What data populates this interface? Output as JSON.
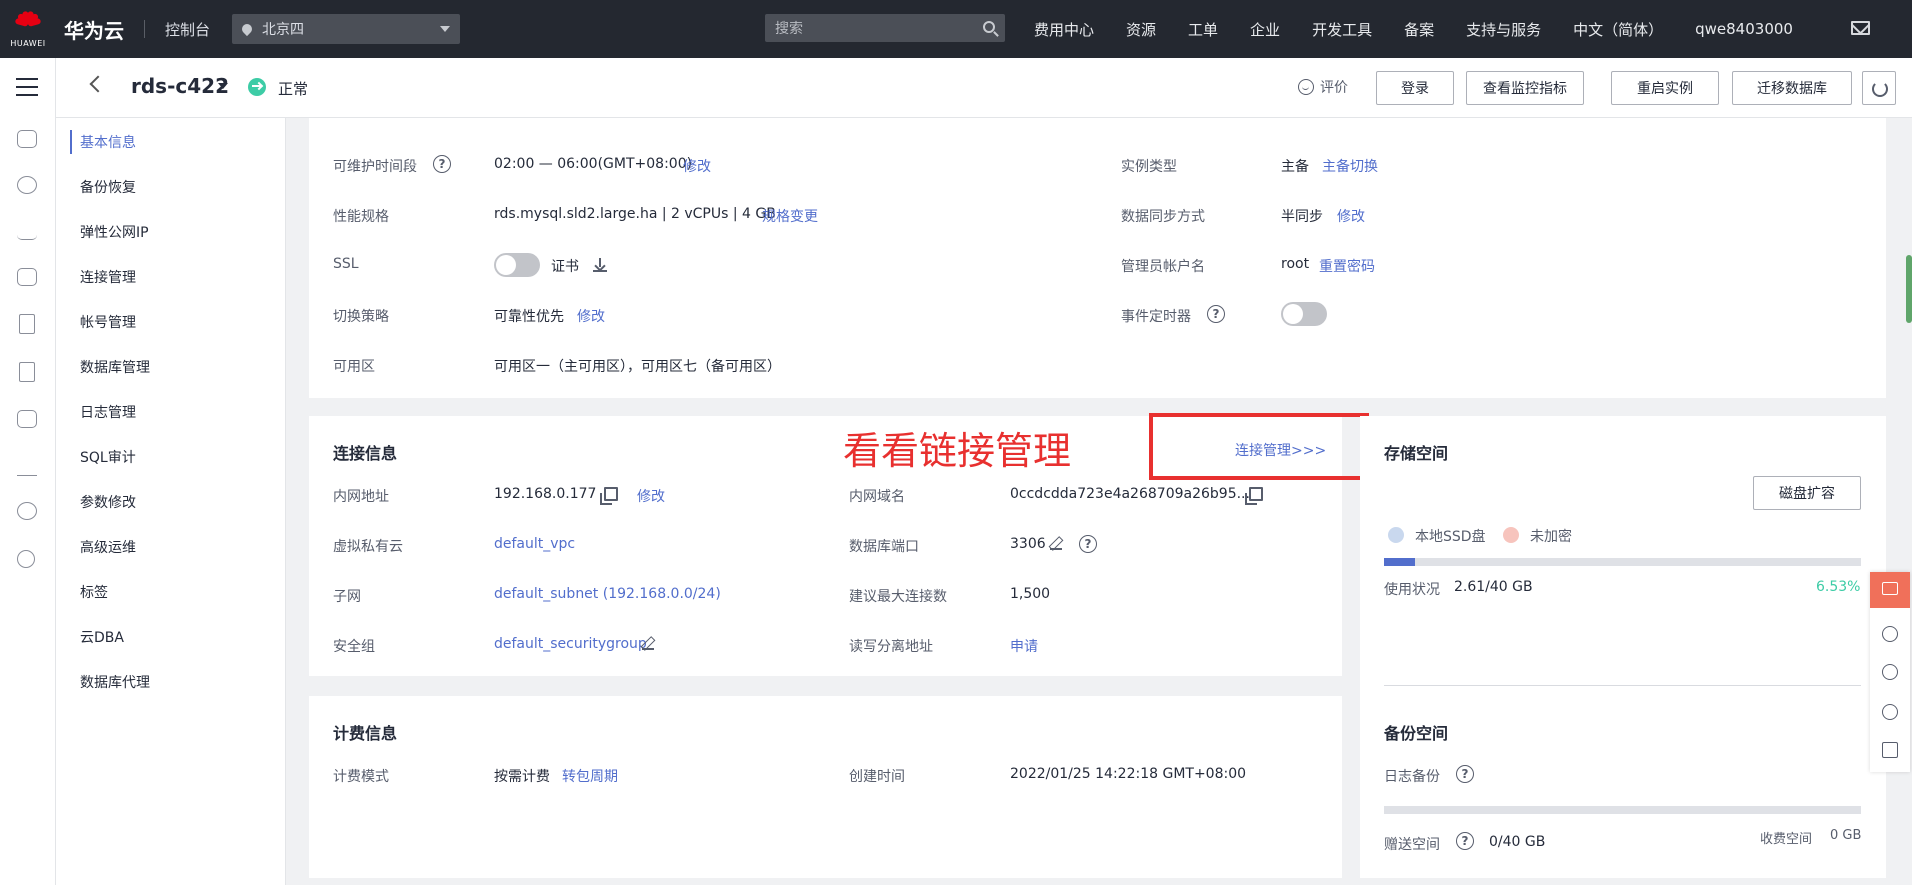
{
  "topnav": {
    "logo_text": "HUAWEI",
    "brand": "华为云",
    "console": "控制台",
    "region": "北京四",
    "search_placeholder": "搜索",
    "links": [
      "费用中心",
      "资源",
      "工单",
      "企业",
      "开发工具",
      "备案",
      "支持与服务",
      "中文（简体）",
      "qwe8403000"
    ]
  },
  "header": {
    "instance_name": "rds-c422",
    "status": "正常",
    "rate": "评价",
    "buttons": [
      "登录",
      "查看监控指标",
      "重启实例",
      "迁移数据库"
    ]
  },
  "rail_icons": [
    "cloud-icon",
    "network-icon",
    "wave-icon",
    "cloud-db-icon",
    "device-icon",
    "storage-icon",
    "cloud-icon-2",
    "anchor-icon",
    "globe-icon",
    "ip-icon"
  ],
  "subnav": {
    "items": [
      "基本信息",
      "备份恢复",
      "弹性公网IP",
      "连接管理",
      "帐号管理",
      "数据库管理",
      "日志管理",
      "SQL审计",
      "参数修改",
      "高级运维",
      "标签",
      "云DBA",
      "数据库代理"
    ]
  },
  "basic": {
    "maint_label": "可维护时间段",
    "maint_value": "02:00 — 06:00(GMT+08:00)",
    "maint_link": "修改",
    "spec_label": "性能规格",
    "spec_value": "rds.mysql.sld2.large.ha | 2 vCPUs | 4 GB",
    "spec_link": "规格变更",
    "ssl_label": "SSL",
    "ssl_cert": "证书",
    "switch_label": "切换策略",
    "switch_value": "可靠性优先",
    "switch_link": "修改",
    "az_label": "可用区",
    "az_value": "可用区一（主可用区），可用区七（备可用区）",
    "type_label": "实例类型",
    "type_value": "主备",
    "type_link": "主备切换",
    "sync_label": "数据同步方式",
    "sync_value": "半同步",
    "sync_link": "修改",
    "admin_label": "管理员帐户名",
    "admin_value": "root",
    "admin_link": "重置密码",
    "event_label": "事件定时器"
  },
  "conn": {
    "title": "连接信息",
    "manage_link": "连接管理>>>",
    "ip_label": "内网地址",
    "ip_value": "192.168.0.177",
    "ip_link": "修改",
    "vpc_label": "虚拟私有云",
    "vpc_value": "default_vpc",
    "subnet_label": "子网",
    "subnet_value": "default_subnet (192.168.0.0/24)",
    "sg_label": "安全组",
    "sg_value": "default_securitygroup",
    "domain_label": "内网域名",
    "domain_value": "0ccdcdda723e4a268709a26b95...",
    "port_label": "数据库端口",
    "port_value": "3306",
    "maxconn_label": "建议最大连接数",
    "maxconn_value": "1,500",
    "rw_label": "读写分离地址",
    "rw_link": "申请"
  },
  "annotation": {
    "text": "看看链接管理"
  },
  "billing": {
    "title": "计费信息",
    "mode_label": "计费模式",
    "mode_value": "按需计费",
    "mode_link": "转包周期",
    "created_label": "创建时间",
    "created_value": "2022/01/25 14:22:18 GMT+08:00"
  },
  "storage": {
    "title": "存储空间",
    "expand_button": "磁盘扩容",
    "legend_ssd": "本地SSD盘",
    "legend_enc": "未加密",
    "usage_label": "使用状况",
    "usage_value": "2.61/40 GB",
    "usage_percent": "6.53%",
    "usage_fraction": 0.0653,
    "backup_title": "备份空间",
    "log_backup_label": "日志备份",
    "free_label": "赠送空间",
    "free_value": "0/40 GB",
    "paid_label": "收费空间",
    "paid_value": "0 GB"
  },
  "colors": {
    "accent": "#526ecc",
    "nav_bg": "#242830",
    "status_green": "#3dcca6",
    "annotation_red": "#e8302f",
    "percent_green": "#3dcca6"
  }
}
